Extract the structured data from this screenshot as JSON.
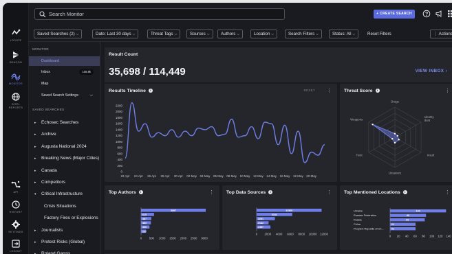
{
  "rail": [
    {
      "label": "LOCATE",
      "icon": "locate-icon"
    },
    {
      "label": "BEACON",
      "icon": "beacon-icon"
    },
    {
      "label": "MONITOR",
      "icon": "monitor-icon"
    },
    {
      "label": "INTEL REPORTS",
      "icon": "globe-icon"
    },
    {
      "label": "API",
      "icon": "api-icon"
    },
    {
      "label": "HISTORY",
      "icon": "history-icon"
    },
    {
      "label": "SETTINGS",
      "icon": "settings-icon"
    },
    {
      "label": "LOGOUT",
      "icon": "logout-icon"
    }
  ],
  "search": {
    "placeholder": "Search Monitor"
  },
  "topbar": {
    "create_label": "+ CREATE SEARCH"
  },
  "filters": [
    "Saved Searches (2)",
    "Date: Last 30 days",
    "Threat Tags",
    "Sources",
    "Authors",
    "Location",
    "Search Filters",
    "Status: All"
  ],
  "reset_filters": "Reset Filters",
  "actions": "⋮ Actions",
  "sidebar": {
    "monitor_title": "MONITOR",
    "dashboard": "Dashboard",
    "inbox": "Inbox",
    "inbox_badge": "108.9k",
    "map": "Map",
    "saved_settings": "Saved Search Settings",
    "saved_title": "SAVED SEARCHES",
    "saved": [
      {
        "label": "Echosec Searches",
        "type": "item"
      },
      {
        "label": "Archive",
        "type": "item"
      },
      {
        "label": "Augusta National 2024",
        "type": "item"
      },
      {
        "label": "Breaking News (Major Cities)",
        "type": "item"
      },
      {
        "label": "Canada",
        "type": "item"
      },
      {
        "label": "Competitors",
        "type": "item"
      },
      {
        "label": "Critical Infrastructure",
        "type": "open"
      },
      {
        "label": "Crisis Situations",
        "type": "sub"
      },
      {
        "label": "Factory Fires or Explosions",
        "type": "sub"
      },
      {
        "label": "Journalists",
        "type": "item"
      },
      {
        "label": "Protest Risks (Global)",
        "type": "item"
      },
      {
        "label": "Roland Garros",
        "type": "item"
      }
    ]
  },
  "result_count": {
    "title": "Result Count",
    "value": "35,698 / 114,449",
    "link": "VIEW INBOX  ›"
  },
  "timeline": {
    "title": "Results Timeline",
    "reset": "RESET"
  },
  "threat": {
    "title": "Threat Score"
  },
  "authors": {
    "title": "Top Authors"
  },
  "sources": {
    "title": "Top Data Sources"
  },
  "locations": {
    "title": "Top Mentioned Locations"
  },
  "chart_data": [
    {
      "type": "line",
      "title": "Results Timeline",
      "x": [
        "22 Apr",
        "23 Apr",
        "24 Apr",
        "25 Apr",
        "26 Apr",
        "27 Apr",
        "28 Apr",
        "29 Apr",
        "30 Apr",
        "1 May",
        "2 May",
        "3 May",
        "4 May",
        "5 May",
        "6 May",
        "7 May",
        "8 May",
        "9 May",
        "10 May",
        "11 May",
        "12 May",
        "13 May",
        "14 May",
        "15 May",
        "16 May",
        "17 May",
        "18 May",
        "19 May",
        "20 May",
        "21 May",
        "22 May"
      ],
      "x_ticks": [
        "22 Apr",
        "24 Apr",
        "26 Apr",
        "28 Apr",
        "30 Apr",
        "02 May",
        "04 May",
        "06 May",
        "08 May",
        "10 May",
        "12 May",
        "14 May",
        "16 May",
        "18 May",
        "20 May"
      ],
      "values": [
        450,
        2300,
        1350,
        1600,
        1150,
        1300,
        1200,
        1400,
        1150,
        1350,
        1200,
        1450,
        1400,
        1500,
        1200,
        1250,
        1750,
        1150,
        1200,
        1500,
        1100,
        1650,
        1600,
        900,
        1550,
        600,
        1350,
        300,
        650,
        550,
        900
      ],
      "ylim": [
        0,
        2200
      ],
      "y_ticks": [
        0,
        200,
        400,
        600,
        800,
        1000,
        1200,
        1400,
        1600,
        1800,
        2000,
        2200
      ],
      "color": "#6f7ee8"
    },
    {
      "type": "radar",
      "title": "Threat Score",
      "axes": [
        "Drugs",
        "Identity theft",
        "Insult",
        "Unsavory",
        "Toxic",
        "Weapons"
      ],
      "values": [
        0.12,
        0.1,
        0.15,
        0.18,
        0.1,
        0.85
      ],
      "color": "#6f7ee8"
    },
    {
      "type": "bar",
      "title": "Top Authors",
      "values": [
        3097,
        615,
        487,
        463,
        400,
        237
      ],
      "xlim": [
        0,
        3000
      ],
      "x_ticks": [
        0,
        500,
        1000,
        1500,
        2000,
        2500,
        3000
      ],
      "color": "#6f7ee8"
    },
    {
      "type": "bar",
      "title": "Top Data Sources",
      "values": [
        11565,
        6344,
        3251,
        2132,
        2457
      ],
      "xlim": [
        0,
        12000
      ],
      "x_ticks": [
        0,
        2000,
        4000,
        6000,
        8000,
        10000,
        12000
      ],
      "color": "#6f7ee8"
    },
    {
      "type": "bar",
      "title": "Top Mentioned Locations",
      "categories": [
        "Ukraine",
        "Russian Federation",
        "Russia",
        "China",
        "People's Republic of Ch..."
      ],
      "values": [
        134,
        86,
        83,
        61,
        61
      ],
      "xlim": [
        0,
        140
      ],
      "x_ticks": [
        0,
        20,
        40,
        60,
        80,
        100,
        120,
        140
      ],
      "color": "#6f7ee8"
    }
  ]
}
